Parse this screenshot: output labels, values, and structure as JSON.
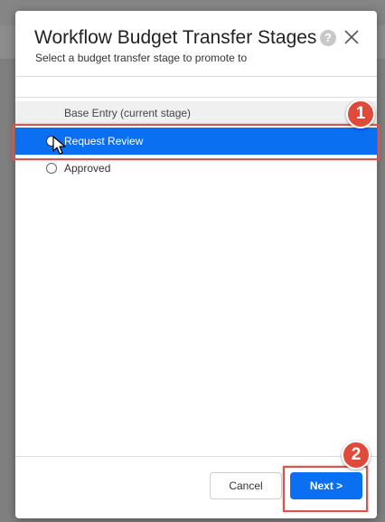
{
  "dialog": {
    "title": "Workflow Budget Transfer Stages",
    "subtitle": "Select a budget transfer stage to promote to",
    "help_icon_glyph": "?",
    "close_icon": "close-icon"
  },
  "stages": {
    "current": "Base Entry (current stage)",
    "options": [
      {
        "label": "Request Review",
        "selected": true
      },
      {
        "label": "Approved",
        "selected": false
      }
    ]
  },
  "footer": {
    "cancel_label": "Cancel",
    "next_label": "Next >"
  },
  "callouts": [
    "1",
    "2"
  ],
  "colors": {
    "selection": "#0a6ff0",
    "callout": "#e04a3a",
    "highlight_border": "#d9534f"
  }
}
